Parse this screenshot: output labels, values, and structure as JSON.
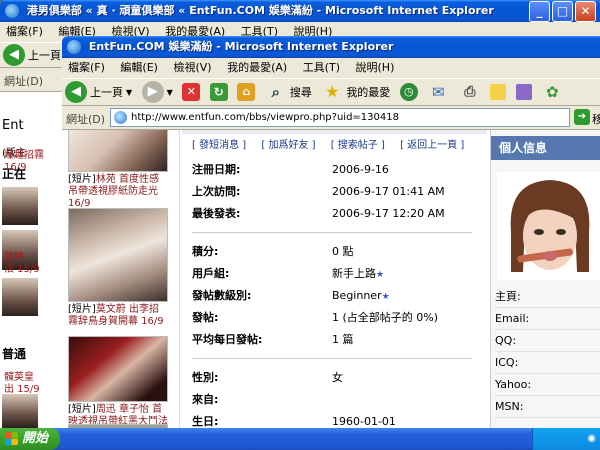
{
  "back_window": {
    "title": "港男俱樂部 « 真 · 頑童俱樂部 « EntFun.COM 娛樂滿紛 - Microsoft Internet Explorer",
    "menu": [
      "檔案(F)",
      "編輯(E)",
      "檢視(V)",
      "我的最愛(A)",
      "工具(T)",
      "說明(H)"
    ],
    "back_label": "上一頁",
    "address_label": "網址(D)",
    "side_texts": [
      "Ent",
      "(版主",
      "正在",
      "爆趣招霧",
      "16/9",
      "首映",
      "法 15/9",
      "普通",
      "髖英皇",
      "出 15/9"
    ]
  },
  "front_window": {
    "title": "EntFun.COM 娛樂滿紛 - Microsoft Internet Explorer",
    "menu": [
      "檔案(F)",
      "編輯(E)",
      "檢視(V)",
      "我的最愛(A)",
      "工具(T)",
      "說明(H)"
    ],
    "toolbar": {
      "back": "上一頁",
      "search": "搜尋",
      "favorites": "我的最愛"
    },
    "address_label": "網址(D)",
    "address_value": "http://www.entfun.com/bbs/viewpro.php?uid=130418",
    "go_label": "移"
  },
  "left_thumbs": [
    {
      "tag": "[短片]",
      "caption": "林苑 首度性感吊帶透視膠紙防走光 16/9"
    },
    {
      "tag": "[短片]",
      "caption": "莫文蔚 出李招霧辞鳥身賀開幕 16/9"
    },
    {
      "tag": "[短片]",
      "caption": "周迅 章子怡 首映透視吊帶紅黑大鬥法 15/9"
    }
  ],
  "links": [
    "[ 發短消息 ]",
    "[ 加爲好友 ]",
    "[ 搜索帖子 ]",
    "[ 返回上一頁 ]"
  ],
  "profile": {
    "rows_group1": [
      {
        "k": "注冊日期:",
        "v": "2006-9-16"
      },
      {
        "k": "上次訪問:",
        "v": "2006-9-17 01:41 AM"
      },
      {
        "k": "最後發表:",
        "v": "2006-9-17 12:20 AM"
      }
    ],
    "rows_group2": [
      {
        "k": "積分:",
        "v": "0 點"
      },
      {
        "k": "用戶組:",
        "v": "新手上路"
      },
      {
        "k": "發帖數級別:",
        "v": "Beginner"
      },
      {
        "k": "發帖:",
        "v": "1 (占全部帖子的 0%)"
      },
      {
        "k": "平均每日發帖:",
        "v": "1 篇"
      }
    ],
    "rows_group3": [
      {
        "k": "性別:",
        "v": "女"
      },
      {
        "k": "來自:",
        "v": ""
      },
      {
        "k": "生日:",
        "v": "1960-01-01"
      }
    ]
  },
  "right_panel": {
    "title": "個人信息",
    "fields": [
      "主頁:",
      "Email:",
      "QQ:",
      "ICQ:",
      "Yahoo:",
      "MSN:"
    ]
  },
  "taskbar": {
    "start": "開始"
  },
  "colors": {
    "accent": "#0a58d8",
    "panel_header": "#5677b0",
    "caption_red": "#8b1a1a"
  }
}
